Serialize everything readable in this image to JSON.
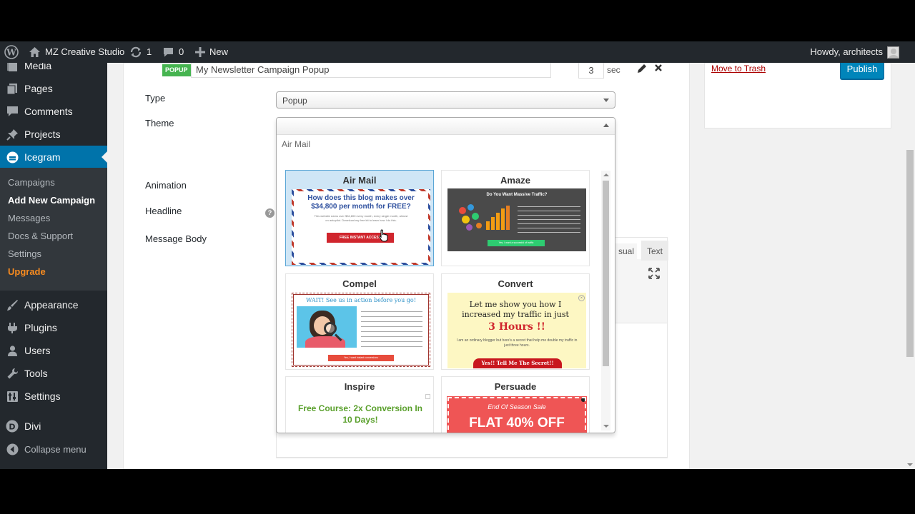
{
  "adminbar": {
    "site_name": "MZ Creative Studio",
    "updates_count": "1",
    "comments_count": "0",
    "new_label": "New",
    "howdy": "Howdy, architects"
  },
  "sidebar": {
    "menu": [
      {
        "label": "Media",
        "icon": "media-icon"
      },
      {
        "label": "Pages",
        "icon": "pages-icon"
      },
      {
        "label": "Comments",
        "icon": "comments-icon"
      },
      {
        "label": "Projects",
        "icon": "pin-icon"
      },
      {
        "label": "Icegram",
        "icon": "icegram-icon"
      },
      {
        "label": "Appearance",
        "icon": "brush-icon"
      },
      {
        "label": "Plugins",
        "icon": "plug-icon"
      },
      {
        "label": "Users",
        "icon": "users-icon"
      },
      {
        "label": "Tools",
        "icon": "wrench-icon"
      },
      {
        "label": "Settings",
        "icon": "settings-icon"
      },
      {
        "label": "Divi",
        "icon": "divi-icon"
      },
      {
        "label": "Collapse menu",
        "icon": "collapse-icon"
      }
    ],
    "submenu": [
      "Campaigns",
      "Add New Campaign",
      "Messages",
      "Docs & Support",
      "Settings",
      "Upgrade"
    ]
  },
  "message": {
    "badge": "POPUP",
    "title_value": "My Newsletter Campaign Popup",
    "delay_value": "3",
    "delay_unit": "sec"
  },
  "form": {
    "type_label": "Type",
    "type_value": "Popup",
    "theme_label": "Theme",
    "animation_label": "Animation",
    "headline_label": "Headline",
    "body_label": "Message Body",
    "help_glyph": "?",
    "editor_tabs": [
      "sual",
      "Text"
    ]
  },
  "theme_dropdown": {
    "search_value": "Air Mail",
    "themes": [
      {
        "name": "Air Mail",
        "headline": "How does this blog makes over $34,800 per month for FREE?",
        "sub": "This website earns over $34,800 every month, every single month, almost on autopilot. Download my free kit to learn how I do this.",
        "button": "FREE INSTANT ACCESS"
      },
      {
        "name": "Amaze",
        "headline": "Do You Want Massive Traffic?",
        "button": "Yes, I want a succesful of traffic"
      },
      {
        "name": "Compel",
        "headline": "WAIT! See us in action before you go!",
        "button": "Yes, I want instant conversions"
      },
      {
        "name": "Convert",
        "headline_1": "Let me show you how I increased my traffic in just",
        "headline_2": "3 Hours !!",
        "sub": "I am an ordinary blogger but here's a secret that help me double my traffic in just three hours.",
        "button": "Yes!! Tell Me The Secret!!"
      },
      {
        "name": "Inspire",
        "headline": "Free Course: 2x Conversion In 10 Days!"
      },
      {
        "name": "Persuade",
        "sub": "End Of Season Sale",
        "headline": "FLAT 40% OFF"
      }
    ]
  },
  "publish_box": {
    "trash_label": "Move to Trash",
    "publish_label": "Publish"
  },
  "colors": {
    "admin_dark": "#23282d",
    "wp_blue": "#0073aa",
    "badge_green": "#46b450",
    "upgrade_orange": "#f88b1f"
  }
}
